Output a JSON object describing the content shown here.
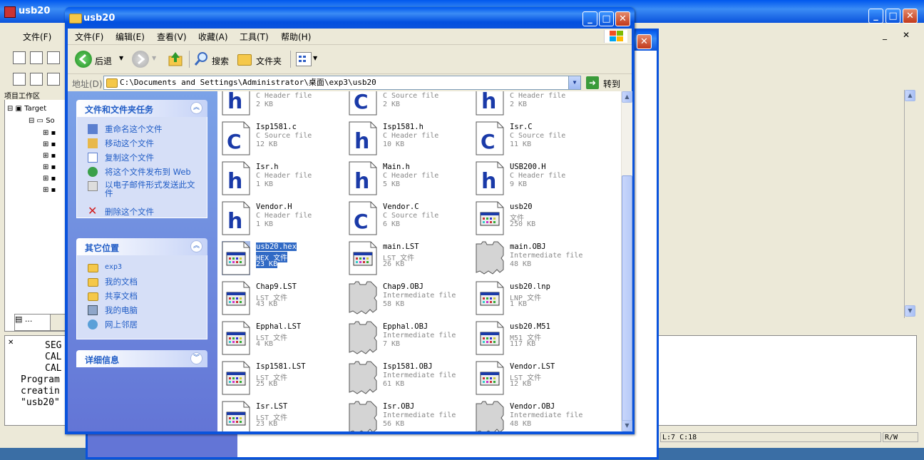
{
  "ide": {
    "title": "usb20",
    "menu_first": "文件(F)",
    "project_header": "项目工作区",
    "tree_root": "Target",
    "tree_child": "So",
    "right_snippet": "转到",
    "output_lines": [
      "SEG",
      "CAL",
      "CAL",
      "Program",
      "creatin",
      "\"usb20\""
    ],
    "bottom_tab_label": "...",
    "status_pos": "L:7 C:18",
    "status_mode": "R/W"
  },
  "window": {
    "title": "usb20"
  },
  "menu": [
    "文件(F)",
    "编辑(E)",
    "查看(V)",
    "收藏(A)",
    "工具(T)",
    "帮助(H)"
  ],
  "toolbar": {
    "back": "后退",
    "search": "搜索",
    "folders": "文件夹"
  },
  "address": {
    "label": "地址(D)",
    "path": "C:\\Documents and Settings\\Administrator\\桌面\\exp3\\usb20",
    "go": "转到"
  },
  "tasks": {
    "file_tasks_title": "文件和文件夹任务",
    "file_tasks": [
      "重命名这个文件",
      "移动这个文件",
      "复制这个文件",
      "将这个文件发布到 Web",
      "以电子邮件形式发送此文件",
      "删除这个文件"
    ],
    "other_places_title": "其它位置",
    "other_places": [
      "exp3",
      "我的文档",
      "共享文档",
      "我的电脑",
      "网上邻居"
    ],
    "details_title": "详细信息"
  },
  "files": [
    {
      "name": "",
      "type": "C Header file",
      "size": "2 KB",
      "icon": "h-file-icon"
    },
    {
      "name": "",
      "type": "C Source file",
      "size": "2 KB",
      "icon": "c-file-icon"
    },
    {
      "name": "",
      "type": "C Header file",
      "size": "2 KB",
      "icon": "h-file-icon"
    },
    {
      "name": "Isp1581.c",
      "type": "C Source file",
      "size": "12 KB",
      "icon": "c-file-icon"
    },
    {
      "name": "Isp1581.h",
      "type": "C Header file",
      "size": "10 KB",
      "icon": "h-file-icon"
    },
    {
      "name": "Isr.C",
      "type": "C Source file",
      "size": "11 KB",
      "icon": "c-file-icon"
    },
    {
      "name": "Isr.h",
      "type": "C Header file",
      "size": "1 KB",
      "icon": "h-file-icon"
    },
    {
      "name": "Main.h",
      "type": "C Header file",
      "size": "5 KB",
      "icon": "h-file-icon"
    },
    {
      "name": "USB200.H",
      "type": "C Header file",
      "size": "9 KB",
      "icon": "h-file-icon"
    },
    {
      "name": "Vendor.H",
      "type": "C Header file",
      "size": "1 KB",
      "icon": "h-file-icon"
    },
    {
      "name": "Vendor.C",
      "type": "C Source file",
      "size": "6 KB",
      "icon": "c-file-icon"
    },
    {
      "name": "usb20",
      "type": "文件",
      "size": "250 KB",
      "icon": "text-file-icon"
    },
    {
      "name": "usb20.hex",
      "type": "HEX 文件",
      "size": "23 KB",
      "icon": "text-file-icon",
      "selected": true
    },
    {
      "name": "main.LST",
      "type": "LST 文件",
      "size": "26 KB",
      "icon": "text-file-icon"
    },
    {
      "name": "main.OBJ",
      "type": "Intermediate file",
      "size": "48 KB",
      "icon": "obj-file-icon"
    },
    {
      "name": "Chap9.LST",
      "type": "LST 文件",
      "size": "43 KB",
      "icon": "text-file-icon"
    },
    {
      "name": "Chap9.OBJ",
      "type": "Intermediate file",
      "size": "58 KB",
      "icon": "obj-file-icon"
    },
    {
      "name": "usb20.lnp",
      "type": "LNP 文件",
      "size": "1 KB",
      "icon": "text-file-icon"
    },
    {
      "name": "Epphal.LST",
      "type": "LST 文件",
      "size": "4 KB",
      "icon": "text-file-icon"
    },
    {
      "name": "Epphal.OBJ",
      "type": "Intermediate file",
      "size": "7 KB",
      "icon": "obj-file-icon"
    },
    {
      "name": "usb20.M51",
      "type": "M51 文件",
      "size": "117 KB",
      "icon": "text-file-icon"
    },
    {
      "name": "Isp1581.LST",
      "type": "LST 文件",
      "size": "25 KB",
      "icon": "text-file-icon"
    },
    {
      "name": "Isp1581.OBJ",
      "type": "Intermediate file",
      "size": "61 KB",
      "icon": "obj-file-icon"
    },
    {
      "name": "Vendor.LST",
      "type": "LST 文件",
      "size": "12 KB",
      "icon": "text-file-icon"
    },
    {
      "name": "Isr.LST",
      "type": "LST 文件",
      "size": "23 KB",
      "icon": "text-file-icon"
    },
    {
      "name": "Isr.OBJ",
      "type": "Intermediate file",
      "size": "56 KB",
      "icon": "obj-file-icon"
    },
    {
      "name": "Vendor.OBJ",
      "type": "Intermediate file",
      "size": "48 KB",
      "icon": "obj-file-icon"
    }
  ]
}
